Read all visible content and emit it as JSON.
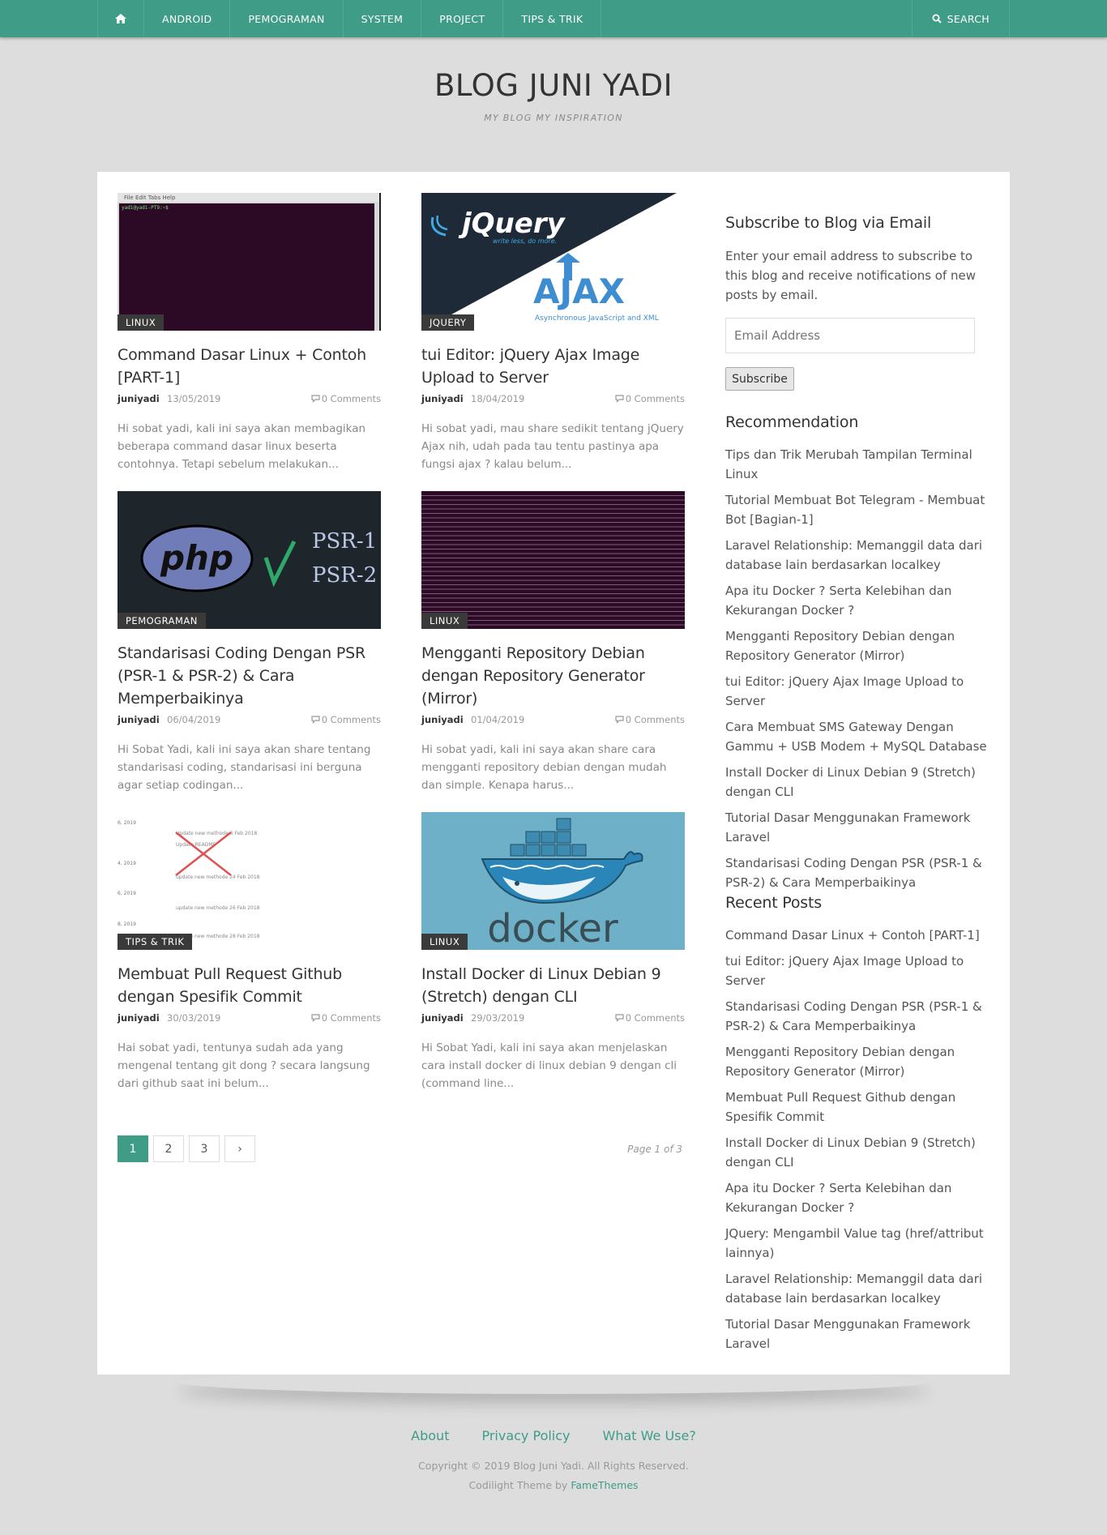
{
  "nav": {
    "items": [
      "ANDROID",
      "PEMOGRAMAN",
      "SYSTEM",
      "PROJECT",
      "TIPS & TRIK"
    ],
    "search_label": "SEARCH",
    "home_icon": "home-icon",
    "search_icon": "search-icon"
  },
  "header": {
    "title": "BLOG JUNI YADI",
    "tagline": "MY BLOG MY INSPIRATION"
  },
  "posts": [
    {
      "category": "LINUX",
      "title": "Command Dasar Linux + Contoh [PART-1]",
      "author": "juniyadi",
      "date": "13/05/2019",
      "comments": "0 Comments",
      "excerpt": "Hi sobat yadi, kali ini saya akan membagikan beberapa command dasar linux beserta contohnya. Tetapi sebelum melakukan...",
      "thumb_text": [
        "File  Edit  Tabs  Help",
        "yadi@yadi-PT9:~$ "
      ]
    },
    {
      "category": "JQUERY",
      "title": "tui Editor: jQuery Ajax Image Upload to Server",
      "author": "juniyadi",
      "date": "18/04/2019",
      "comments": "0 Comments",
      "excerpt": "Hi sobat yadi, mau share sedikit tentang jQuery Ajax nih, udah pada tau tentu pastinya apa fungsi ajax ? kalau belum...",
      "thumb_text": [
        "jQuery",
        "write less, do more.",
        "AJAX",
        "Asynchronous JavaScript and XML"
      ]
    },
    {
      "category": "PEMOGRAMAN",
      "title": "Standarisasi Coding Dengan PSR (PSR-1 & PSR-2) & Cara Memperbaikinya",
      "author": "juniyadi",
      "date": "06/04/2019",
      "comments": "0 Comments",
      "excerpt": "Hi Sobat Yadi, kali ini saya akan share tentang standarisasi coding, standarisasi ini berguna agar setiap codingan...",
      "thumb_text": [
        "php",
        "PSR-1",
        "PSR-2"
      ]
    },
    {
      "category": "LINUX",
      "title": "Mengganti Repository Debian dengan Repository Generator (Mirror)",
      "author": "juniyadi",
      "date": "01/04/2019",
      "comments": "0 Comments",
      "excerpt": "Hi sobat yadi, kali ini saya akan share cara mengganti repository debian dengan mudah dan simple. Kenapa harus...",
      "thumb_text": []
    },
    {
      "category": "TIPS & TRIK",
      "title": "Membuat Pull Request Github dengan Spesifik Commit",
      "author": "juniyadi",
      "date": "30/03/2019",
      "comments": "0 Comments",
      "excerpt": "Hai sobat yadi, tentunya sudah ada yang mengenal tentang git dong ? secara langsung dari github saat ini belum...",
      "thumb_text": [
        "6, 2019",
        "4, 2019",
        "6, 2019",
        "8, 2019",
        "Update new methode 6 Feb 2018",
        "Update README",
        "update new methode 24 Feb 2018",
        "update new methode 26 Feb 2018",
        "update new methode 28 Feb 2018"
      ]
    },
    {
      "category": "LINUX",
      "title": "Install Docker di Linux Debian 9 (Stretch) dengan CLI",
      "author": "juniyadi",
      "date": "29/03/2019",
      "comments": "0 Comments",
      "excerpt": "Hi Sobat Yadi, kali ini saya akan menjelaskan cara install docker di linux debian 9 dengan cli (command line...",
      "thumb_text": [
        "docker"
      ]
    }
  ],
  "pagination": {
    "pages": [
      "1",
      "2",
      "3",
      "›"
    ],
    "active": "1",
    "info": "Page 1 of 3"
  },
  "sidebar": {
    "subscribe": {
      "title": "Subscribe to Blog via Email",
      "text": "Enter your email address to subscribe to this blog and receive notifications of new posts by email.",
      "placeholder": "Email Address",
      "button": "Subscribe"
    },
    "recommendation": {
      "title": "Recommendation",
      "items": [
        "Tips dan Trik Merubah Tampilan Terminal Linux",
        "Tutorial Membuat Bot Telegram - Membuat Bot [Bagian-1]",
        "Laravel Relationship: Memanggil data dari database lain berdasarkan localkey",
        "Apa itu Docker ? Serta Kelebihan dan Kekurangan Docker ?",
        "Mengganti Repository Debian dengan Repository Generator (Mirror)",
        "tui Editor: jQuery Ajax Image Upload to Server",
        "Cara Membuat SMS Gateway Dengan Gammu + USB Modem + MySQL Database",
        "Install Docker di Linux Debian 9 (Stretch) dengan CLI",
        "Tutorial Dasar Menggunakan Framework Laravel",
        "Standarisasi Coding Dengan PSR (PSR-1 & PSR-2) & Cara Memperbaikinya"
      ]
    },
    "recent": {
      "title": "Recent Posts",
      "items": [
        "Command Dasar Linux + Contoh [PART-1]",
        "tui Editor: jQuery Ajax Image Upload to Server",
        "Standarisasi Coding Dengan PSR (PSR-1 & PSR-2) & Cara Memperbaikinya",
        "Mengganti Repository Debian dengan Repository Generator (Mirror)",
        "Membuat Pull Request Github dengan Spesifik Commit",
        "Install Docker di Linux Debian 9 (Stretch) dengan CLI",
        "Apa itu Docker ? Serta Kelebihan dan Kekurangan Docker ?",
        "JQuery: Mengambil Value tag (href/attribut lainnya)",
        "Laravel Relationship: Memanggil data dari database lain berdasarkan localkey",
        "Tutorial Dasar Menggunakan Framework Laravel"
      ]
    }
  },
  "footer": {
    "links": [
      "About",
      "Privacy Policy",
      "What We Use?"
    ],
    "copyright": "Copyright © 2019 Blog Juni Yadi. All Rights Reserved.",
    "credit_prefix": "Codilight Theme by",
    "credit_link": "FameThemes"
  },
  "colors": {
    "accent": "#3f9c86",
    "background": "#dddddd",
    "category_badge": "#3a3a3a"
  }
}
